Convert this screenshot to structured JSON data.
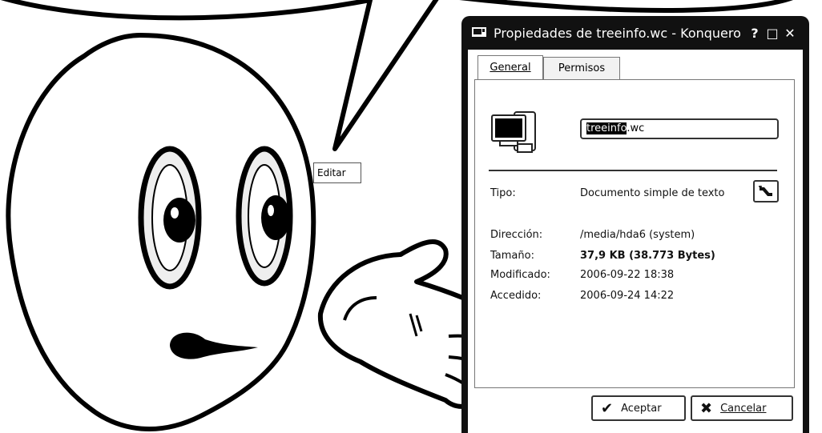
{
  "window": {
    "title": "Propiedades de treeinfo.wc - Konquero",
    "help_label": "?",
    "maximize_label": "□",
    "close_label": "✕"
  },
  "tabs": [
    "General",
    "Permisos"
  ],
  "file": {
    "name_selected": "treeinfo",
    "name_suffix": ".wc",
    "icon": "text-document-icon"
  },
  "properties": [
    {
      "label": "Tipo:",
      "value": "Documento simple de texto"
    },
    {
      "label": "Dirección:",
      "value": "/media/hda6 (system)"
    },
    {
      "label": "Tamaño:",
      "value": "37,9 KB (38.773 Bytes)"
    },
    {
      "label": "Modificado:",
      "value": "2006-09-22 18:38"
    },
    {
      "label": "Accedido:",
      "value": "2006-09-24 14:22"
    }
  ],
  "edit_tooltip": "Editar",
  "buttons": {
    "ok": "Aceptar",
    "cancel": "Cancelar"
  },
  "icons": {
    "edit": "wand-icon",
    "ok": "checkmark-icon",
    "cancel": "x-icon"
  }
}
